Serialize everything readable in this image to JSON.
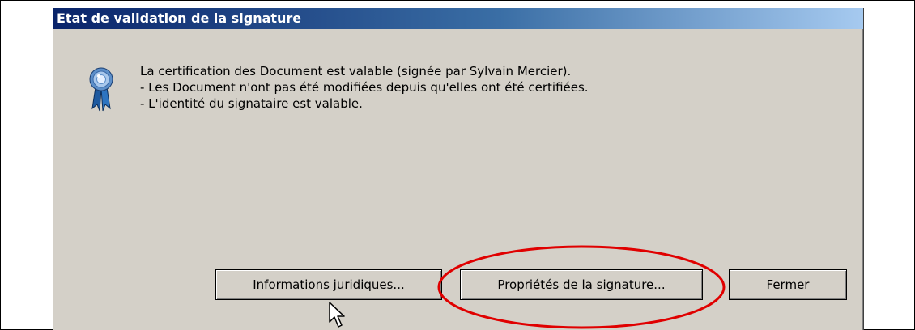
{
  "dialog": {
    "title": "Etat de validation de la signature",
    "icon": "certificate-ribbon-icon",
    "messages": [
      "La certification des Document est valable (signée par Sylvain Mercier).",
      "- Les Document n'ont pas été modifiées depuis qu'elles ont été certifiées.",
      "- L'identité du signataire est valable."
    ]
  },
  "buttons": {
    "legal_label": "Informations juridiques...",
    "properties_label": "Propriétés de la signature...",
    "close_label": "Fermer"
  },
  "colors": {
    "titlebar_start": "#0a246a",
    "titlebar_end": "#a6caf0",
    "dialog_bg": "#d4d0c8",
    "annotation": "#e00000"
  }
}
